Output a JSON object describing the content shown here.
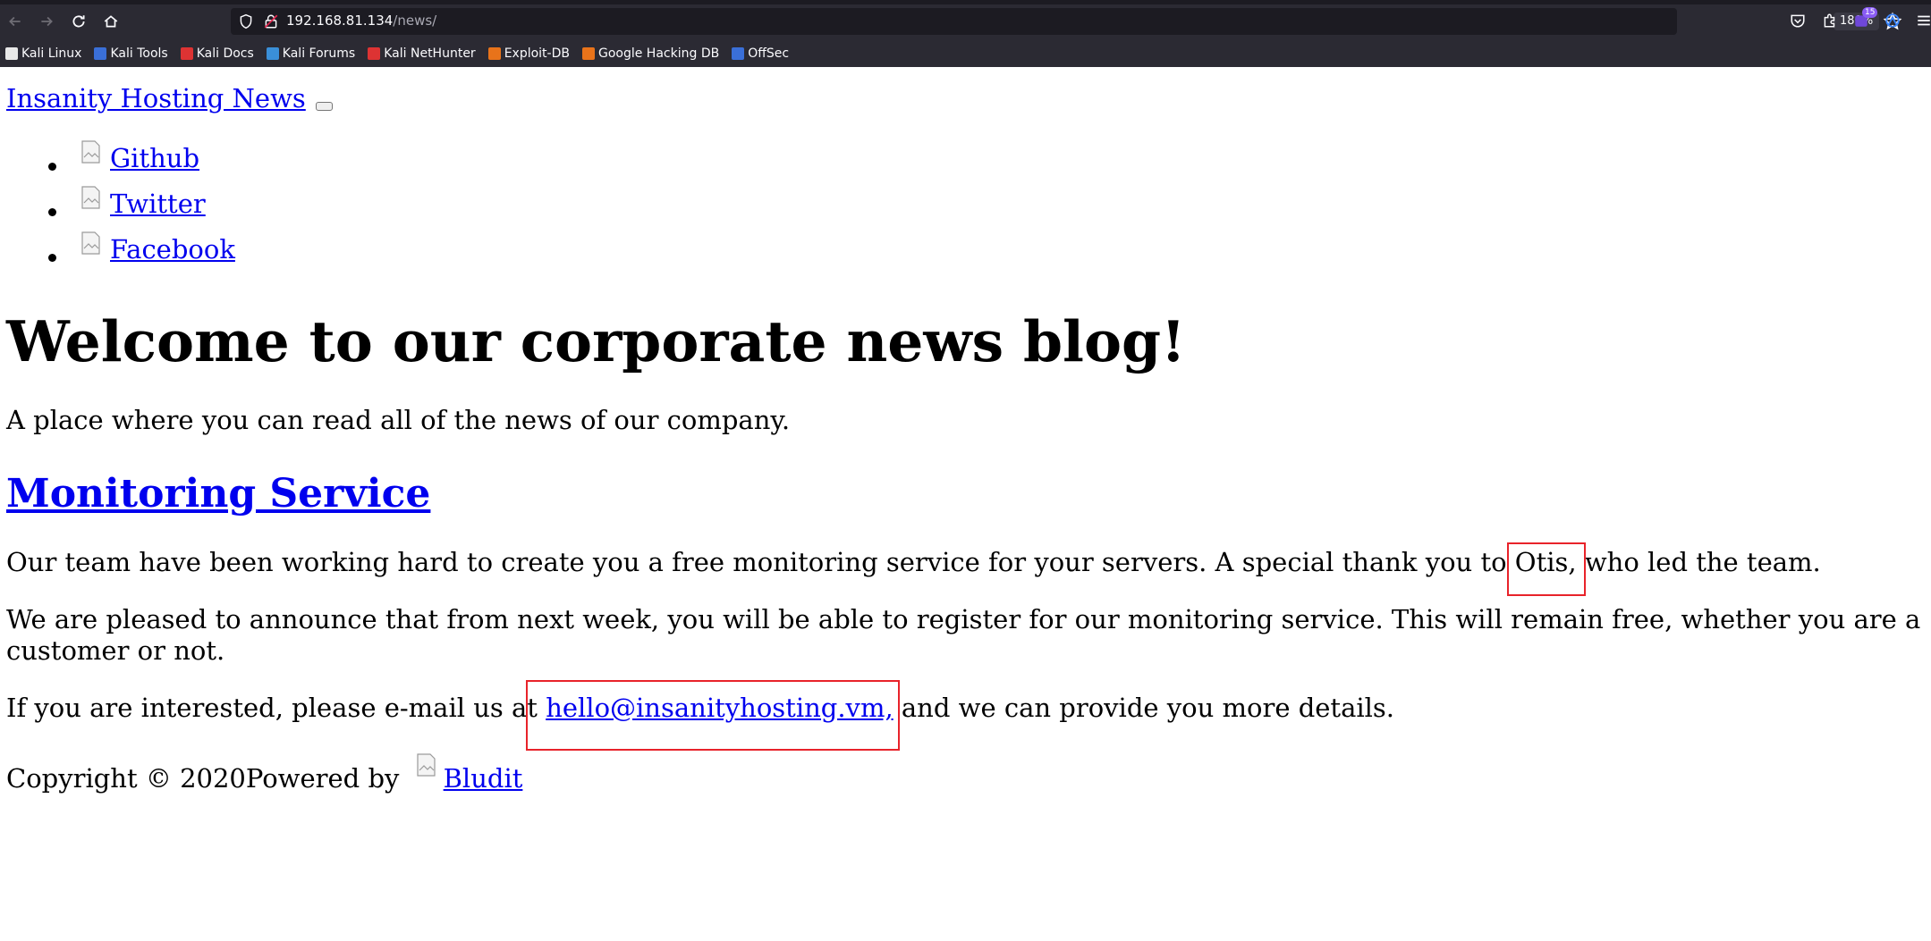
{
  "browser": {
    "url_host": "192.168.81.134",
    "url_path": "/news/",
    "zoom": "180%",
    "extensions_badge": "15",
    "bookmarks": [
      {
        "label": "Kali Linux",
        "icon": "kali-dragon-icon",
        "color": "#e8e8e8"
      },
      {
        "label": "Kali Tools",
        "icon": "kali-tools-icon",
        "color": "#3a6fd8"
      },
      {
        "label": "Kali Docs",
        "icon": "kali-docs-icon",
        "color": "#d33"
      },
      {
        "label": "Kali Forums",
        "icon": "kali-forums-icon",
        "color": "#3a8fd8"
      },
      {
        "label": "Kali NetHunter",
        "icon": "nethunter-icon",
        "color": "#d33"
      },
      {
        "label": "Exploit-DB",
        "icon": "exploit-db-icon",
        "color": "#e8731a"
      },
      {
        "label": "Google Hacking DB",
        "icon": "ghdb-icon",
        "color": "#e8731a"
      },
      {
        "label": "OffSec",
        "icon": "offsec-icon",
        "color": "#3a6fd8"
      }
    ]
  },
  "site": {
    "title": "Insanity Hosting News ",
    "social": [
      {
        "label": " Github"
      },
      {
        "label": " Twitter"
      },
      {
        "label": " Facebook"
      }
    ],
    "welcome": "Welcome to our corporate news blog!",
    "tagline": "A place where you can read all of the news of our company.",
    "post": {
      "title": "Monitoring Service",
      "p1_before": "Our team have been working hard to create you a free monitoring service for your servers. A special thank you to ",
      "p1_name": "Otis,",
      "p1_after": " who led the team.",
      "p2_line1": "We are pleased to announce that from next week, you will be able to register for our monitoring service. This will remain free, whether you are a",
      "p2_line2": "customer or not.",
      "p3_before": "If you are interested, please e-mail us at ",
      "p3_email": "hello@insanityhosting.vm,",
      "p3_after": " and we can provide you more details."
    },
    "footer": {
      "copyright": "Copyright © 2020Powered by ",
      "brand": "Bludit"
    }
  },
  "colors": {
    "highlight_box": "#e8232a",
    "link": "#0000ee",
    "chrome_bg": "#2b2a33"
  }
}
